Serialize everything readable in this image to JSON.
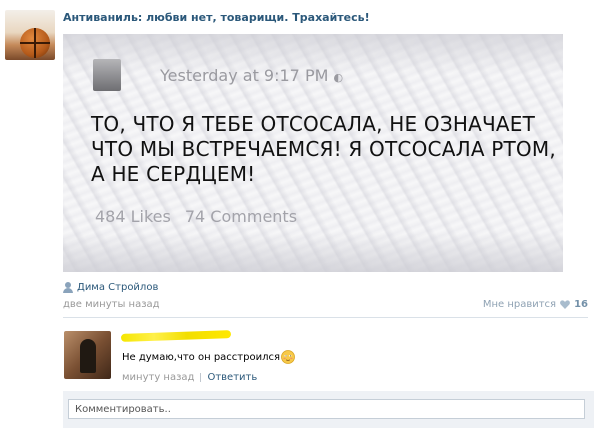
{
  "post": {
    "group_name": "Антиваниль: любви нет, товарищи. Трахайтесь!",
    "image": {
      "timestamp": "Yesterday at 9:17 PM",
      "status_lines": [
        "ТО, ЧТО Я ТЕБЕ ОТСОСАЛА, НЕ ОЗНАЧАЕТ",
        "ЧТО МЫ ВСТРЕЧАЕМСЯ! Я ОТСОСАЛА РТОМ,",
        "А НЕ СЕРДЦЕМ!"
      ],
      "likes": "484 Likes",
      "comments": "74 Comments"
    },
    "author": "Дима Стройлов",
    "time": "две минуты назад",
    "like_label": "Мне нравится",
    "like_count": "16"
  },
  "comment": {
    "text": "Не думаю,что он расстроился",
    "time": "минуту назад",
    "reply_label": "Ответить"
  },
  "comment_input": {
    "placeholder": "Комментировать.."
  },
  "colors": {
    "link": "#2b587a",
    "muted": "#999999",
    "separator": "#dae1e8",
    "input_border": "#c5ced7",
    "comment_area_bg": "#eef1f5"
  }
}
